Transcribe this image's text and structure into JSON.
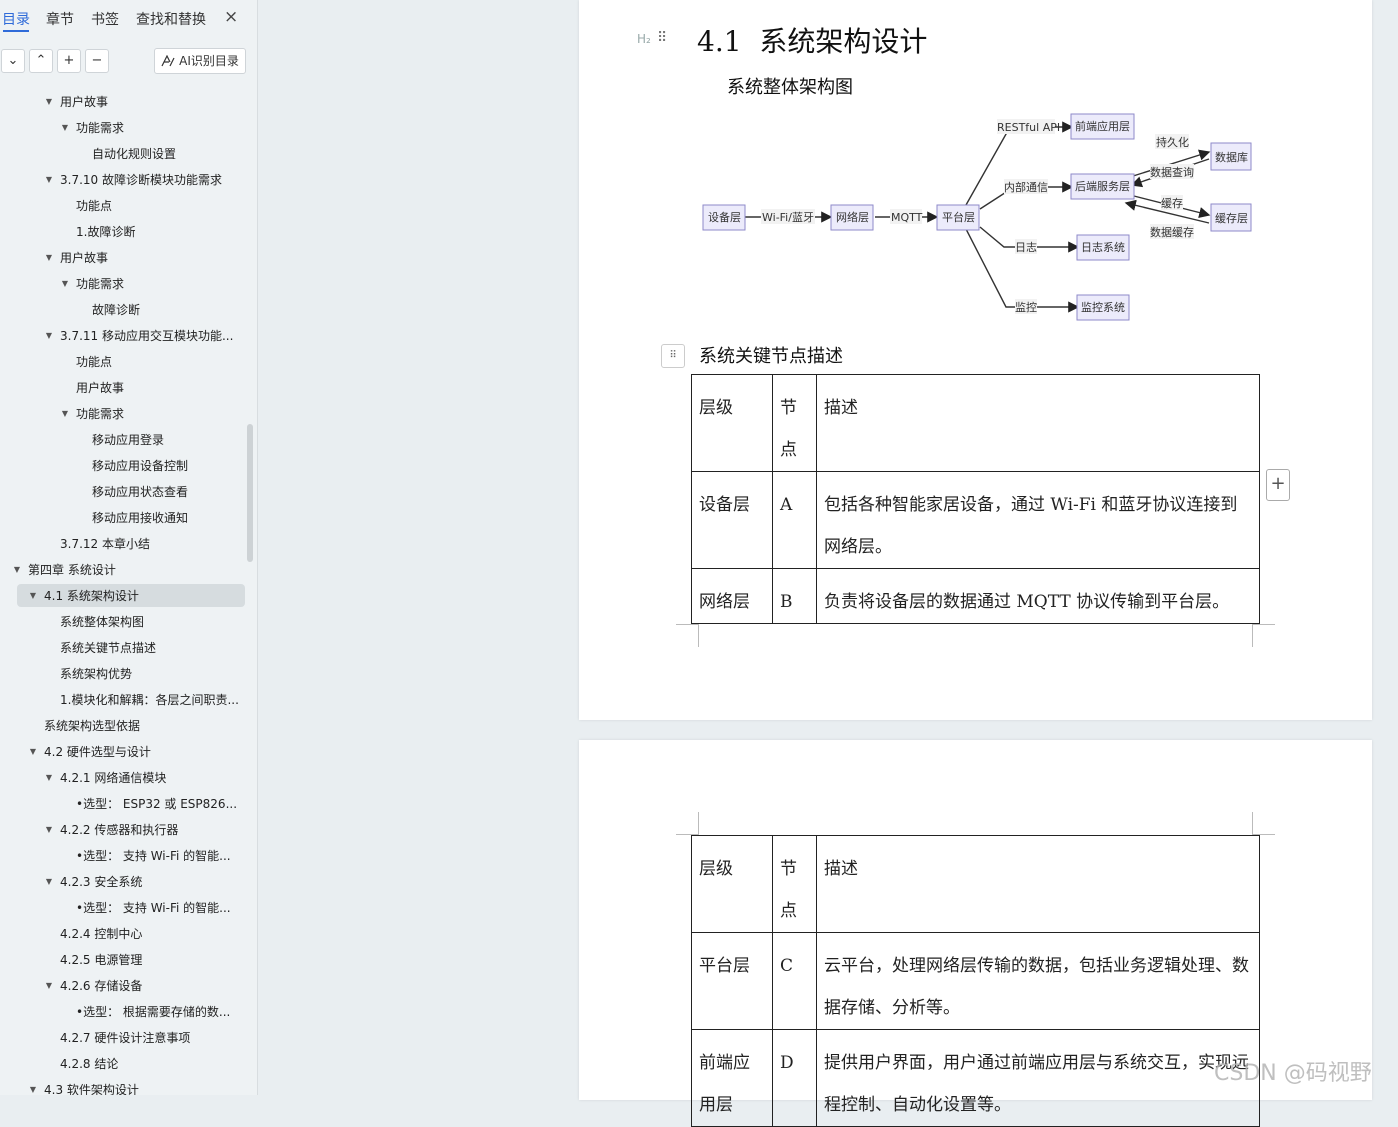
{
  "sidebar": {
    "tabs": [
      "目录",
      "章节",
      "书签",
      "查找和替换"
    ],
    "active_tab": "目录",
    "close_icon": "×",
    "toolbar": {
      "expand": "⌄",
      "collapse": "⌃",
      "add": "+",
      "remove": "−",
      "ai_label": "AI识别目录"
    },
    "toc": [
      {
        "label": "用户故事",
        "arrow": "▼"
      },
      {
        "label": "功能需求",
        "arrow": "▼"
      },
      {
        "label": "自动化规则设置",
        "arrow": ""
      },
      {
        "label": "3.7.10 故障诊断模块功能需求",
        "arrow": "▼"
      },
      {
        "label": "功能点",
        "arrow": ""
      },
      {
        "label": "1.故障诊断",
        "arrow": ""
      },
      {
        "label": "用户故事",
        "arrow": "▼"
      },
      {
        "label": "功能需求",
        "arrow": "▼"
      },
      {
        "label": "故障诊断",
        "arrow": ""
      },
      {
        "label": "3.7.11 移动应用交互模块功能...",
        "arrow": "▼"
      },
      {
        "label": "功能点",
        "arrow": ""
      },
      {
        "label": "用户故事",
        "arrow": ""
      },
      {
        "label": "功能需求",
        "arrow": "▼"
      },
      {
        "label": "移动应用登录",
        "arrow": ""
      },
      {
        "label": "移动应用设备控制",
        "arrow": ""
      },
      {
        "label": "移动应用状态查看",
        "arrow": ""
      },
      {
        "label": "移动应用接收通知",
        "arrow": ""
      },
      {
        "label": "3.7.12 本章小结",
        "arrow": ""
      },
      {
        "label": "第四章 系统设计",
        "arrow": "▼"
      },
      {
        "label": "4.1 系统架构设计",
        "arrow": "▼"
      },
      {
        "label": "系统整体架构图",
        "arrow": ""
      },
      {
        "label": "系统关键节点描述",
        "arrow": ""
      },
      {
        "label": "系统架构优势",
        "arrow": ""
      },
      {
        "label": "1.模块化和解耦：各层之间职责...",
        "arrow": ""
      },
      {
        "label": "系统架构选型依据",
        "arrow": ""
      },
      {
        "label": "4.2 硬件选型与设计",
        "arrow": "▼"
      },
      {
        "label": "4.2.1 网络通信模块",
        "arrow": "▼"
      },
      {
        "label": "•选型： ESP32 或 ESP826...",
        "arrow": ""
      },
      {
        "label": "4.2.2 传感器和执行器",
        "arrow": "▼"
      },
      {
        "label": "•选型： 支持 Wi-Fi 的智能...",
        "arrow": ""
      },
      {
        "label": "4.2.3 安全系统",
        "arrow": "▼"
      },
      {
        "label": "•选型： 支持 Wi-Fi 的智能...",
        "arrow": ""
      },
      {
        "label": "4.2.4 控制中心",
        "arrow": ""
      },
      {
        "label": "4.2.5 电源管理",
        "arrow": ""
      },
      {
        "label": "4.2.6 存储设备",
        "arrow": "▼"
      },
      {
        "label": "•选型： 根据需要存储的数...",
        "arrow": ""
      },
      {
        "label": "4.2.7 硬件设计注意事项",
        "arrow": ""
      },
      {
        "label": "4.2.8 结论",
        "arrow": ""
      },
      {
        "label": "4.3 软件架构设计",
        "arrow": "▼"
      }
    ]
  },
  "doc": {
    "heading_tag": "H₂",
    "heading_number": "4.1",
    "heading_text": "系统架构设计",
    "figure_caption": "系统整体架构图",
    "table_caption": "系统关键节点描述",
    "diagram": {
      "nodes": {
        "device": "设备层",
        "network": "网络层",
        "platform": "平台层",
        "frontend": "前端应用层",
        "backend": "后端服务层",
        "log": "日志系统",
        "monitor": "监控系统",
        "db": "数据库",
        "cache": "缓存层"
      },
      "edges": {
        "wifi": "Wi-Fi/蓝牙",
        "mqtt": "MQTT",
        "restful": "RESTful API",
        "internal": "内部通信",
        "log": "日志",
        "monitor": "监控",
        "persist": "持久化",
        "query": "数据查询",
        "cache": "缓存",
        "datacache": "数据缓存"
      }
    },
    "table1": {
      "header": [
        "层级",
        "节点",
        "描述"
      ],
      "rows": [
        [
          "设备层",
          "A",
          "包括各种智能家居设备，通过 Wi-Fi 和蓝牙协议连接到网络层。"
        ],
        [
          "网络层",
          "B",
          "负责将设备层的数据通过 MQTT 协议传输到平台层。"
        ]
      ]
    },
    "table2": {
      "header": [
        "层级",
        "节点",
        "描述"
      ],
      "rows": [
        [
          "平台层",
          "C",
          "云平台，处理网络层传输的数据，包括业务逻辑处理、数据存储、分析等。"
        ],
        [
          "前端应用层",
          "D",
          "提供用户界面，用户通过前端应用层与系统交互，实现远程控制、自动化设置等。"
        ]
      ]
    }
  },
  "watermark": "CSDN @码视野"
}
